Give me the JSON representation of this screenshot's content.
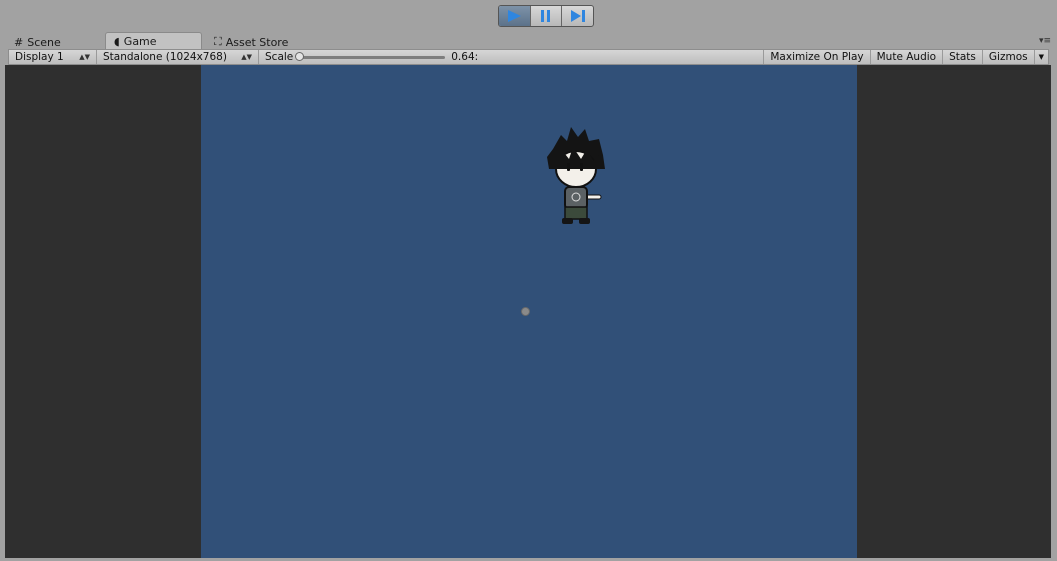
{
  "play_controls": {
    "play_icon": "play-icon",
    "pause_icon": "pause-icon",
    "step_icon": "step-icon",
    "accent": "#2f86e0"
  },
  "tabs": [
    {
      "label": "Scene",
      "icon": "grid-icon"
    },
    {
      "label": "Game",
      "icon": "pacman-icon"
    },
    {
      "label": "Asset Store",
      "icon": "bag-icon"
    }
  ],
  "game_toolbar": {
    "display": "Display 1",
    "resolution": "Standalone (1024x768)",
    "scale_label": "Scale",
    "scale_value": "0.64:",
    "maximize_on_play": "Maximize On Play",
    "mute_audio": "Mute Audio",
    "stats": "Stats",
    "gizmos": "Gizmos"
  },
  "viewport": {
    "background": "#2f2f2f",
    "game_background": "#315078"
  }
}
